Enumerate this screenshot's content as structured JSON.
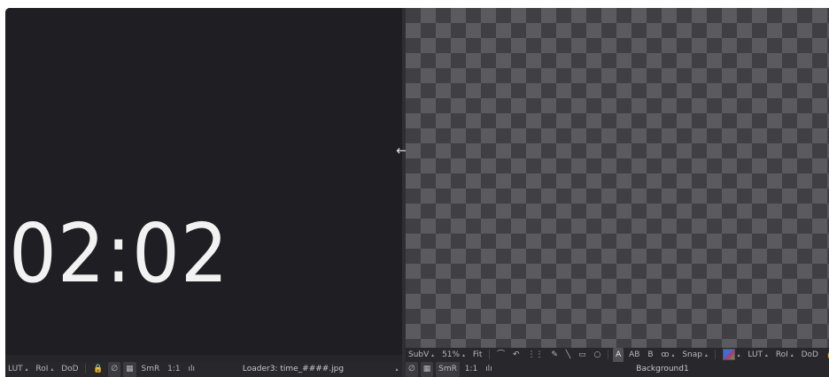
{
  "left_viewer": {
    "timecode": "02:02",
    "toolbar": {
      "lut": "LUT",
      "roi": "RoI",
      "dod": "DoD",
      "lock_glyph": "🔒",
      "smr": "SmR",
      "ratio": "1:1",
      "audio_glyph": "ılı",
      "title": "Loader3: time_####.jpg"
    }
  },
  "right_viewer": {
    "tools": {
      "subv": "SubV",
      "zoom": "51%",
      "fit": "Fit",
      "text_a": "A",
      "text_ab": "AB",
      "text_b": "B",
      "snap": "Snap",
      "lut": "LUT",
      "roi": "RoI",
      "dod": "DoD",
      "lock_glyph": "🔒"
    },
    "toolbar": {
      "smr": "SmR",
      "ratio": "1:1",
      "audio_glyph": "ılı",
      "title": "Background1"
    }
  },
  "glyphs": {
    "arrow": "▴",
    "move": "⟷",
    "curve": "⌒",
    "poly": "↶",
    "grid": "⋮⋮",
    "pen": "✎",
    "line": "╲",
    "rect": "▭",
    "circle": "○",
    "glasses": "ꝏ",
    "nodef": "∅",
    "checker": "▦"
  },
  "colors": {
    "left_bg": "#1f1f23",
    "checker_dark": "#3f3f44",
    "checker_light": "#5a5a5f",
    "toolbar": "#28282c"
  }
}
